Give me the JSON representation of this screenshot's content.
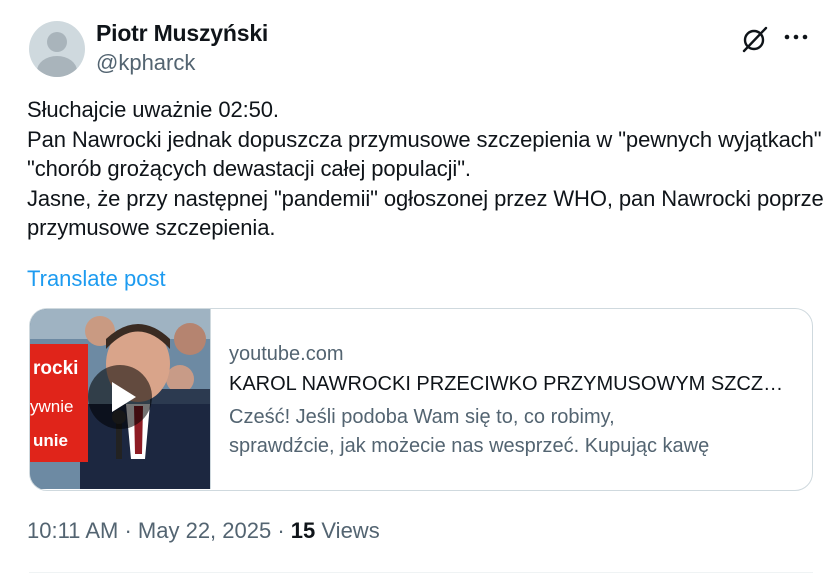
{
  "author": {
    "display_name": "Piotr Muszyński",
    "handle": "@kpharck"
  },
  "header_icons": [
    "grok-icon",
    "more-icon"
  ],
  "post": {
    "text": "Słuchajcie uważnie 02:50.\nPan Nawrocki jednak dopuszcza przymusowe szczepienia w \"pewnych wyjątkach\" \"chorób grożących dewastacji całej populacji\".\nJasne, że przy następnej \"pandemii\" ogłoszonej przez WHO, pan Nawrocki poprze przymusowe szczepienia.",
    "translate_label": "Translate post"
  },
  "link_card": {
    "domain": "youtube.com",
    "title": "KAROL NAWROCKI PRZECIWKO PRZYMUSOWYM SZCZEPIENIOM",
    "description_line1": "Cześć! Jeśli podoba Wam się to, co robimy,",
    "description_line2": "sprawdźcie, jak możecie nas wesprzeć. Kupując kawę",
    "thumbnail_overlay": [
      "rocki",
      "ywnie",
      "unie"
    ],
    "accent_color": "#e0241a"
  },
  "meta": {
    "time": "10:11 AM",
    "separator": "·",
    "date": "May 22, 2025",
    "views_count": "15",
    "views_label": "Views"
  },
  "colors": {
    "text_primary": "#0f1419",
    "text_secondary": "#536471",
    "link": "#1d9bf0",
    "border": "#cfd9de"
  }
}
